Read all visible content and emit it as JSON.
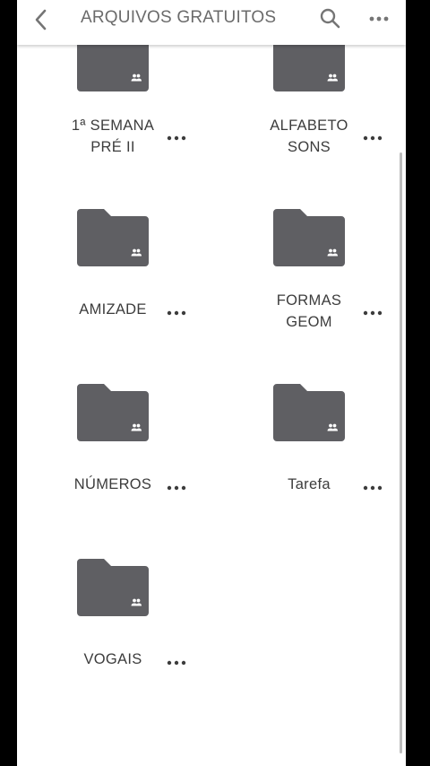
{
  "header": {
    "title": "ARQUIVOS GRATUITOS",
    "back_icon": "chevron-left-icon",
    "search_icon": "search-icon",
    "more_icon": "more-horizontal-icon"
  },
  "folders": [
    {
      "lines": [
        "1ª SEMANA",
        "PRÉ II"
      ],
      "shared": true
    },
    {
      "lines": [
        "ALFABETO",
        "SONS"
      ],
      "shared": true
    },
    {
      "lines": [
        "AMIZADE"
      ],
      "shared": true
    },
    {
      "lines": [
        "FORMAS",
        "GEOM"
      ],
      "shared": true
    },
    {
      "lines": [
        "NÚMEROS"
      ],
      "shared": true
    },
    {
      "lines": [
        "Tarefa"
      ],
      "shared": true
    },
    {
      "lines": [
        "VOGAIS"
      ],
      "shared": true
    }
  ],
  "colors": {
    "folder": "#5f5f63",
    "shared_glyph": "#ffffff",
    "text": "#3c3c3c",
    "icon": "#757575"
  }
}
